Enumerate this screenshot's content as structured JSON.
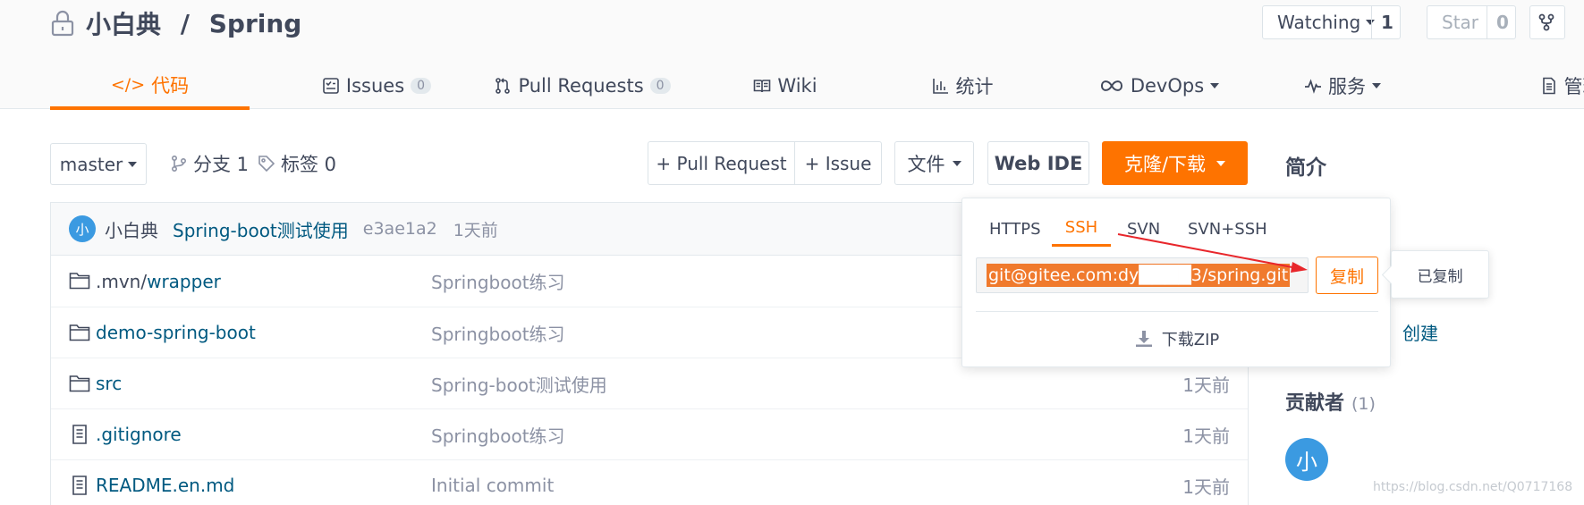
{
  "repo": {
    "owner": "小白典",
    "separator": " / ",
    "name": "Spring"
  },
  "header_actions": {
    "watch_label": "Watching",
    "watch_count": "1",
    "star_label": "Star",
    "star_count": "0"
  },
  "nav_tabs": [
    {
      "label": "代码",
      "icon": "code-icon",
      "active": true
    },
    {
      "label": "Issues",
      "icon": "issues-icon",
      "badge": "0"
    },
    {
      "label": "Pull Requests",
      "icon": "pull-request-icon",
      "badge": "0"
    },
    {
      "label": "Wiki",
      "icon": "book-icon"
    },
    {
      "label": "统计",
      "icon": "bar-chart-icon"
    },
    {
      "label": "DevOps",
      "icon": "infinity-icon"
    },
    {
      "label": "服务",
      "icon": "pulse-icon"
    },
    {
      "label": "管理",
      "icon": "document-icon"
    }
  ],
  "toolbar": {
    "branch": "master",
    "branches_label": "分支 1",
    "tags_label": "标签 0",
    "new_pr_label": "+ Pull Request",
    "new_issue_label": "+ Issue",
    "file_label": "文件",
    "web_ide_label": "Web IDE",
    "clone_label": "克隆/下载"
  },
  "sidebar": {
    "intro_title": "简介",
    "create_label": "创建",
    "contributors_title": "贡献者",
    "contributors_count": "(1)",
    "contributor_avatar": "小"
  },
  "commit": {
    "avatar": "小",
    "author": "小白典",
    "message": "Spring-boot测试使用",
    "hash": "e3ae1a2",
    "time": "1天前"
  },
  "files": [
    {
      "type": "folder",
      "name_dim": ".mvn/",
      "name": "wrapper",
      "message": "Springboot练习",
      "time": ""
    },
    {
      "type": "folder",
      "name_dim": "",
      "name": "demo-spring-boot",
      "message": "Springboot练习",
      "time": ""
    },
    {
      "type": "folder",
      "name_dim": "",
      "name": "src",
      "message": "Spring-boot测试使用",
      "time": "1天前"
    },
    {
      "type": "file",
      "name_dim": "",
      "name": ".gitignore",
      "message": "Springboot练习",
      "time": "1天前"
    },
    {
      "type": "file",
      "name_dim": "",
      "name": "README.en.md",
      "message": "Initial commit",
      "time": "1天前"
    }
  ],
  "clone_dropdown": {
    "protocols": [
      {
        "label": "HTTPS",
        "active": false
      },
      {
        "label": "SSH",
        "active": true
      },
      {
        "label": "SVN",
        "active": false
      },
      {
        "label": "SVN+SSH",
        "active": false
      }
    ],
    "url": "git@gitee.com:dy████3/spring.git",
    "copy_label": "复制",
    "copied_tooltip": "已复制",
    "zip_label": "下载ZIP"
  },
  "colors": {
    "accent": "#fe7300",
    "link": "#005980",
    "avatar": "#3b9ae1",
    "annotation_arrow": "#e8262b"
  },
  "watermark": "https://blog.csdn.net/Q0717168"
}
